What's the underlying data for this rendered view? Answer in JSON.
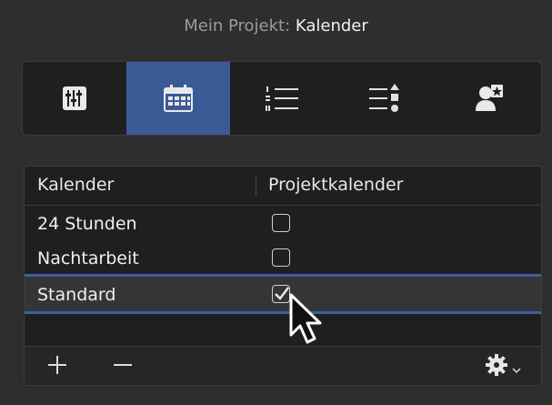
{
  "title": {
    "prefix": "Mein Projekt:",
    "value": "Kalender"
  },
  "toolbar": {
    "active_index": 1,
    "tabs": [
      {
        "icon": "sliders-icon"
      },
      {
        "icon": "calendar-icon"
      },
      {
        "icon": "numbered-list-icon"
      },
      {
        "icon": "sort-list-icon"
      },
      {
        "icon": "person-star-icon"
      }
    ]
  },
  "table": {
    "columns": [
      "Kalender",
      "Projektkalender"
    ],
    "rows": [
      {
        "name": "24 Stunden",
        "checked": false
      },
      {
        "name": "Nachtarbeit",
        "checked": false
      },
      {
        "name": "Standard",
        "checked": true
      }
    ],
    "selected_row": 2
  },
  "footer": {
    "add_icon": "plus-icon",
    "remove_icon": "minus-icon",
    "action_icon": "gear-icon"
  },
  "colors": {
    "accent": "#3c5fa6",
    "background": "#2e2e2e",
    "panel": "#1f1f1f"
  }
}
